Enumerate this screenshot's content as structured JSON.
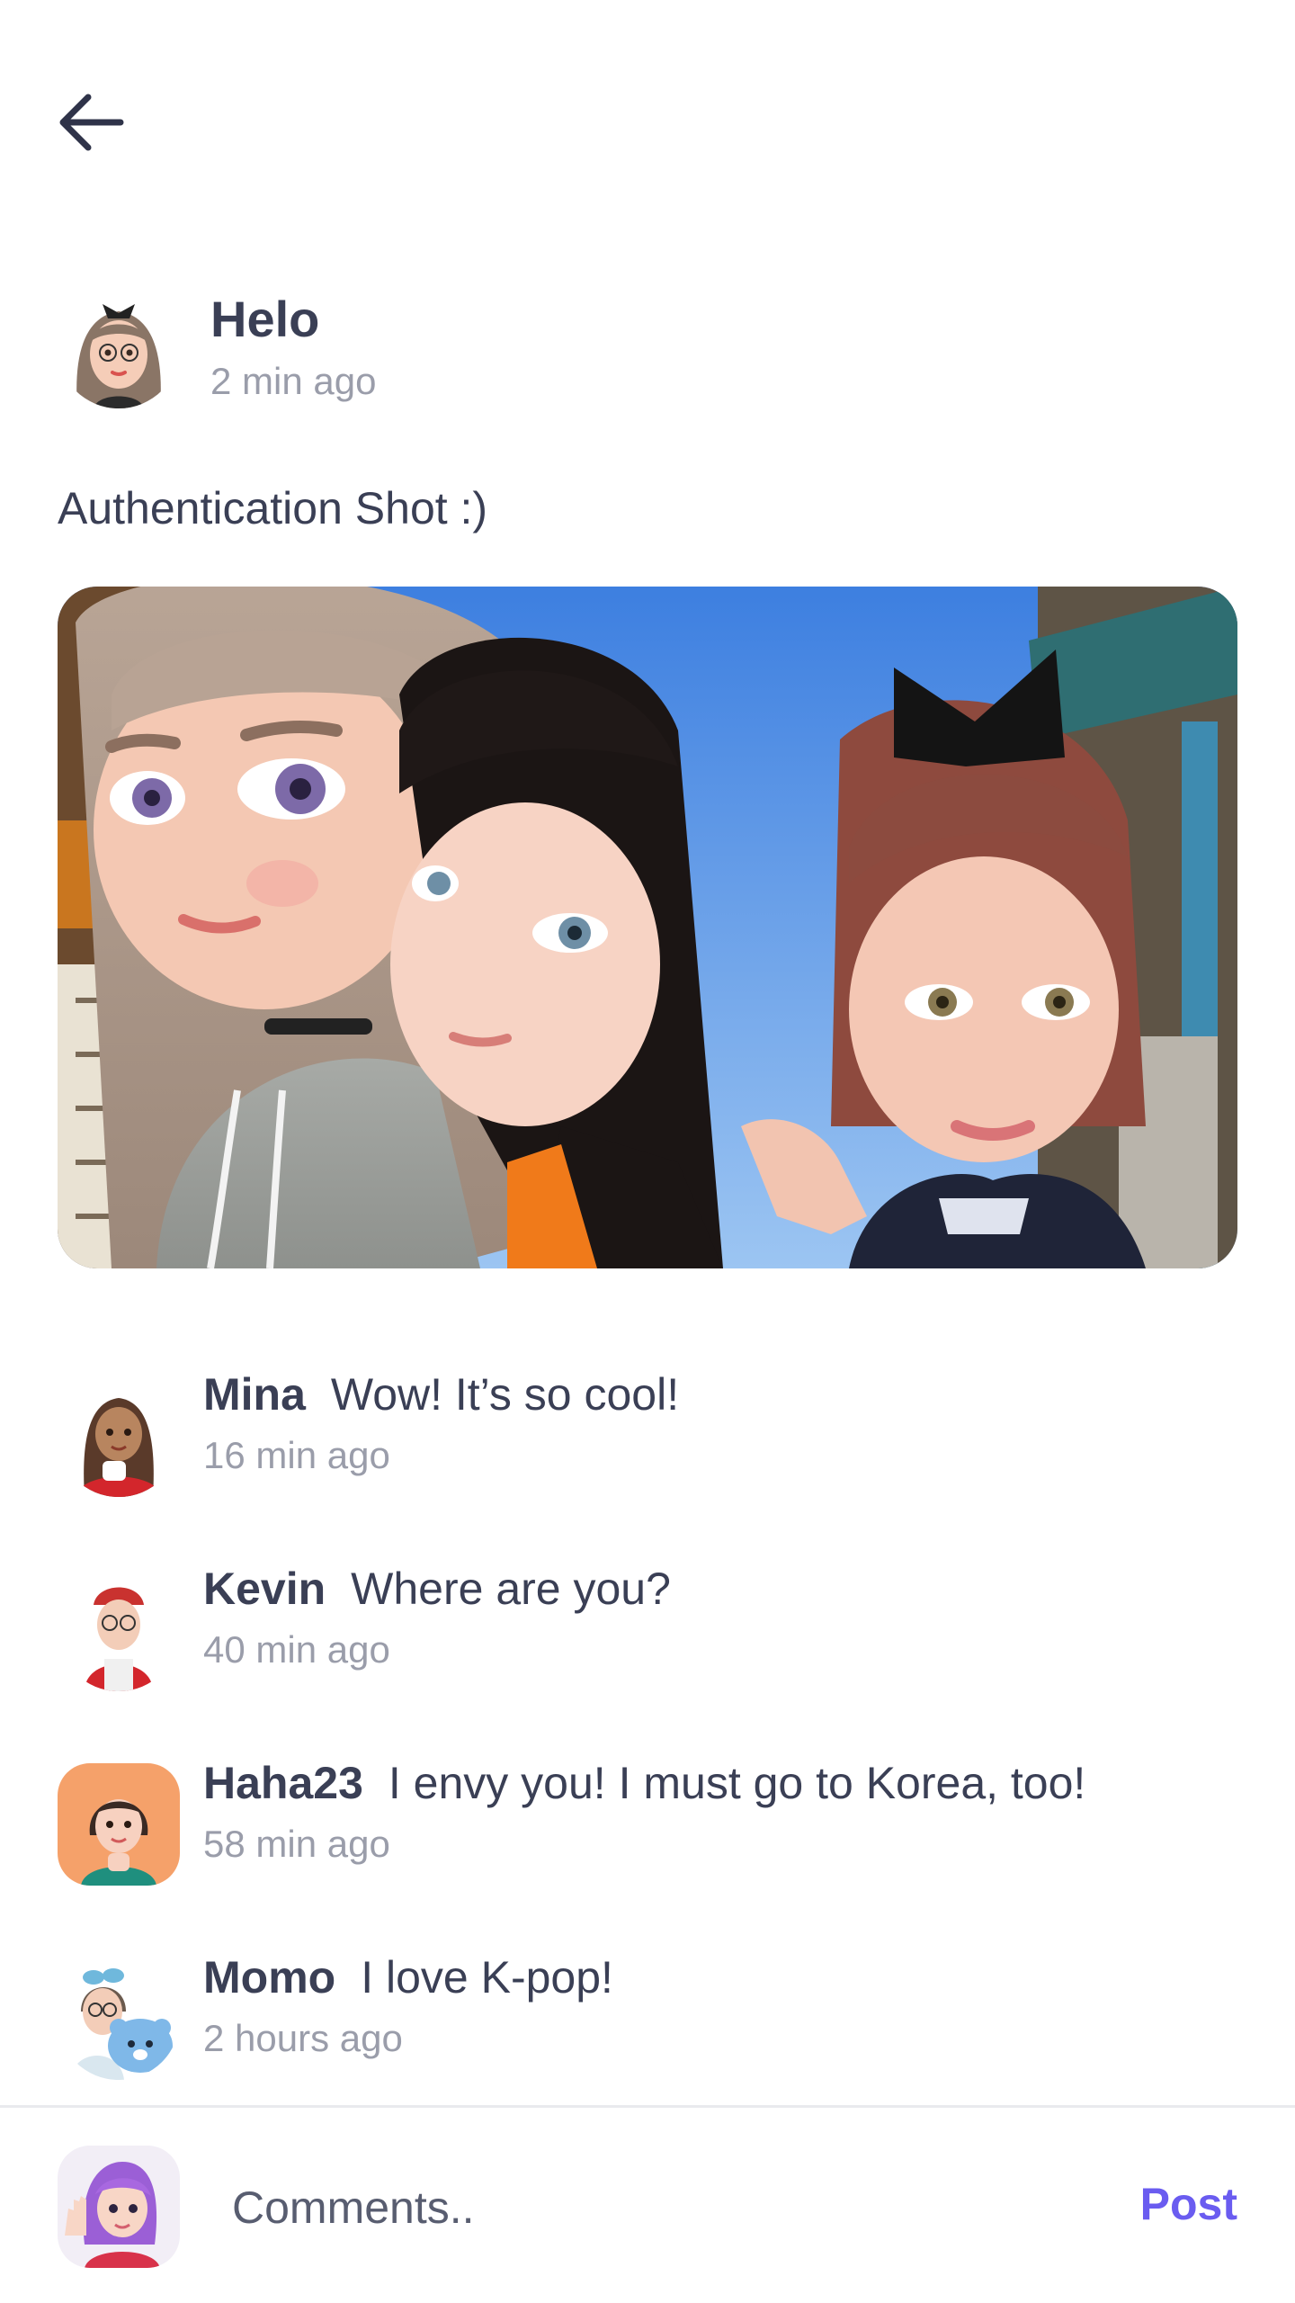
{
  "nav": {
    "back_icon": "arrow-left-icon"
  },
  "post": {
    "author": "Helo",
    "time": "2 min ago",
    "text": "Authentication Shot :)",
    "image_icon": "group-selfie-photo"
  },
  "comments": [
    {
      "user": "Mina",
      "text": "Wow! It’s so cool!",
      "time": "16 min ago"
    },
    {
      "user": "Kevin",
      "text": "Where are you?",
      "time": "40 min ago"
    },
    {
      "user": "Haha23",
      "text": "I envy you! I must go to Korea, too!",
      "time": "58 min ago"
    },
    {
      "user": "Momo",
      "text": "I love K-pop!",
      "time": "2 hours ago"
    }
  ],
  "composer": {
    "placeholder": "Comments..",
    "post_label": "Post"
  },
  "colors": {
    "text": "#3a3f55",
    "muted": "#9a9daa",
    "accent": "#6a5cf0",
    "divider": "#e9eaee"
  }
}
